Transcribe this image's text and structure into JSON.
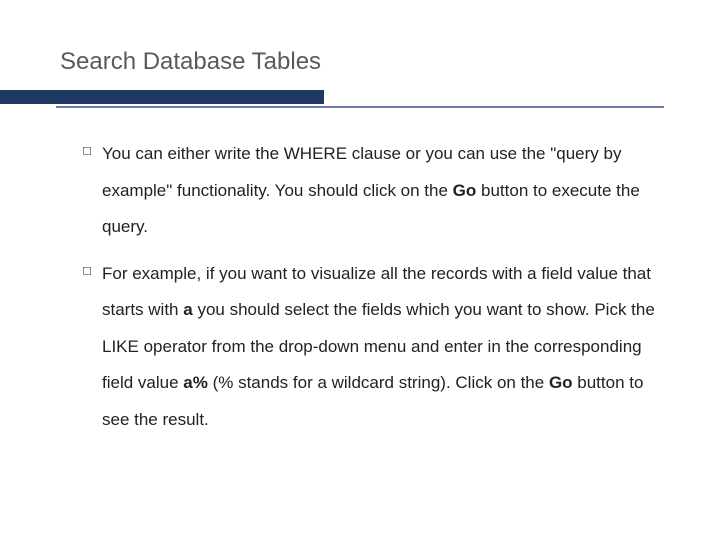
{
  "title": "Search Database Tables",
  "bullets": {
    "b1": {
      "pre": "You can either write the WHERE clause or you can use the \"query by example\" functionality. You should click on the ",
      "bold": "Go",
      "post": " button to execute the query."
    },
    "b2": {
      "p1": "For example, if you want to visualize all the records with a field value that starts with ",
      "bold1": "a",
      "p2": " you should select the fields which you want to show. Pick the LIKE operator from the drop-down menu and enter in the corresponding field value ",
      "bold2": "a%",
      "p3": " (% stands for a wildcard string). Click on the ",
      "bold3": "Go",
      "p4": " button to see the result."
    }
  }
}
